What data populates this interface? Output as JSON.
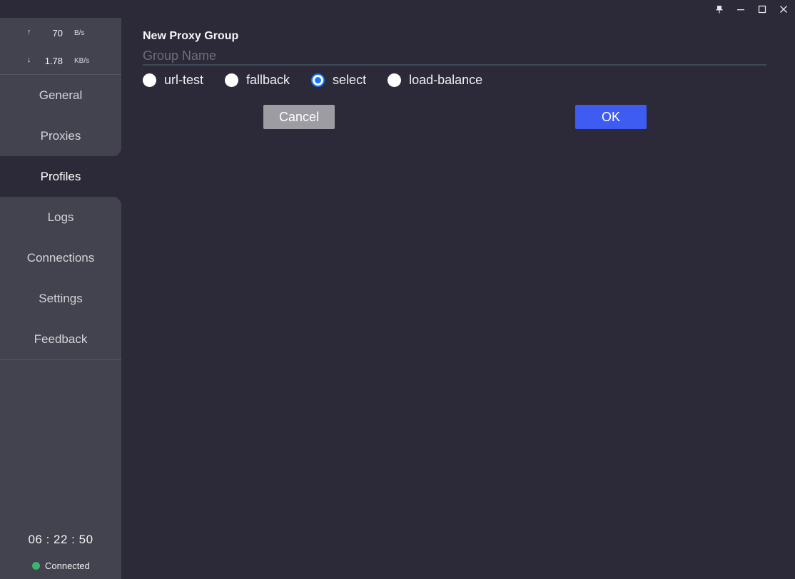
{
  "window": {
    "controls": [
      {
        "name": "pin",
        "icon": "pin-icon"
      },
      {
        "name": "minimize",
        "icon": "minimize-icon"
      },
      {
        "name": "maximize",
        "icon": "maximize-icon"
      },
      {
        "name": "close",
        "icon": "close-icon"
      }
    ]
  },
  "sidebar": {
    "upload": {
      "arrow": "↑",
      "value": "70",
      "unit": "B/s"
    },
    "download": {
      "arrow": "↓",
      "value": "1.78",
      "unit": "KB/s"
    },
    "items": [
      {
        "label": "General",
        "active": false
      },
      {
        "label": "Proxies",
        "active": false
      },
      {
        "label": "Profiles",
        "active": true
      },
      {
        "label": "Logs",
        "active": false
      },
      {
        "label": "Connections",
        "active": false
      },
      {
        "label": "Settings",
        "active": false
      },
      {
        "label": "Feedback",
        "active": false
      }
    ],
    "clock": "06 : 22 : 50",
    "status": {
      "label": "Connected",
      "color": "#3cb371"
    }
  },
  "dialog": {
    "title": "New Proxy Group",
    "name_input": {
      "value": "",
      "placeholder": "Group Name"
    },
    "types": [
      {
        "label": "url-test",
        "checked": false
      },
      {
        "label": "fallback",
        "checked": false
      },
      {
        "label": "select",
        "checked": true
      },
      {
        "label": "load-balance",
        "checked": false
      }
    ],
    "cancel_label": "Cancel",
    "ok_label": "OK"
  },
  "colors": {
    "background": "#2c2a38",
    "sidebar": "#43424f",
    "accent": "#3e5cf2",
    "radio_checked": "#1677ff",
    "cancel_button": "#9d9ca3"
  }
}
